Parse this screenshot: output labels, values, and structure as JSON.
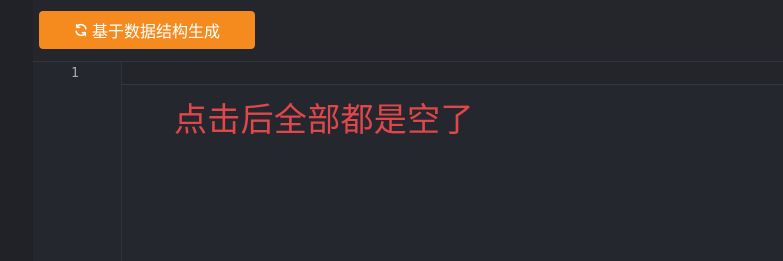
{
  "toolbar": {
    "generate_button_label": "基于数据结构生成",
    "generate_button_icon": "refresh-icon",
    "accent_color": "#f58b1f"
  },
  "editor": {
    "line_numbers": [
      "1"
    ],
    "content": ""
  },
  "annotation": {
    "text": "点击后全部都是空了",
    "color": "#e0474b"
  }
}
